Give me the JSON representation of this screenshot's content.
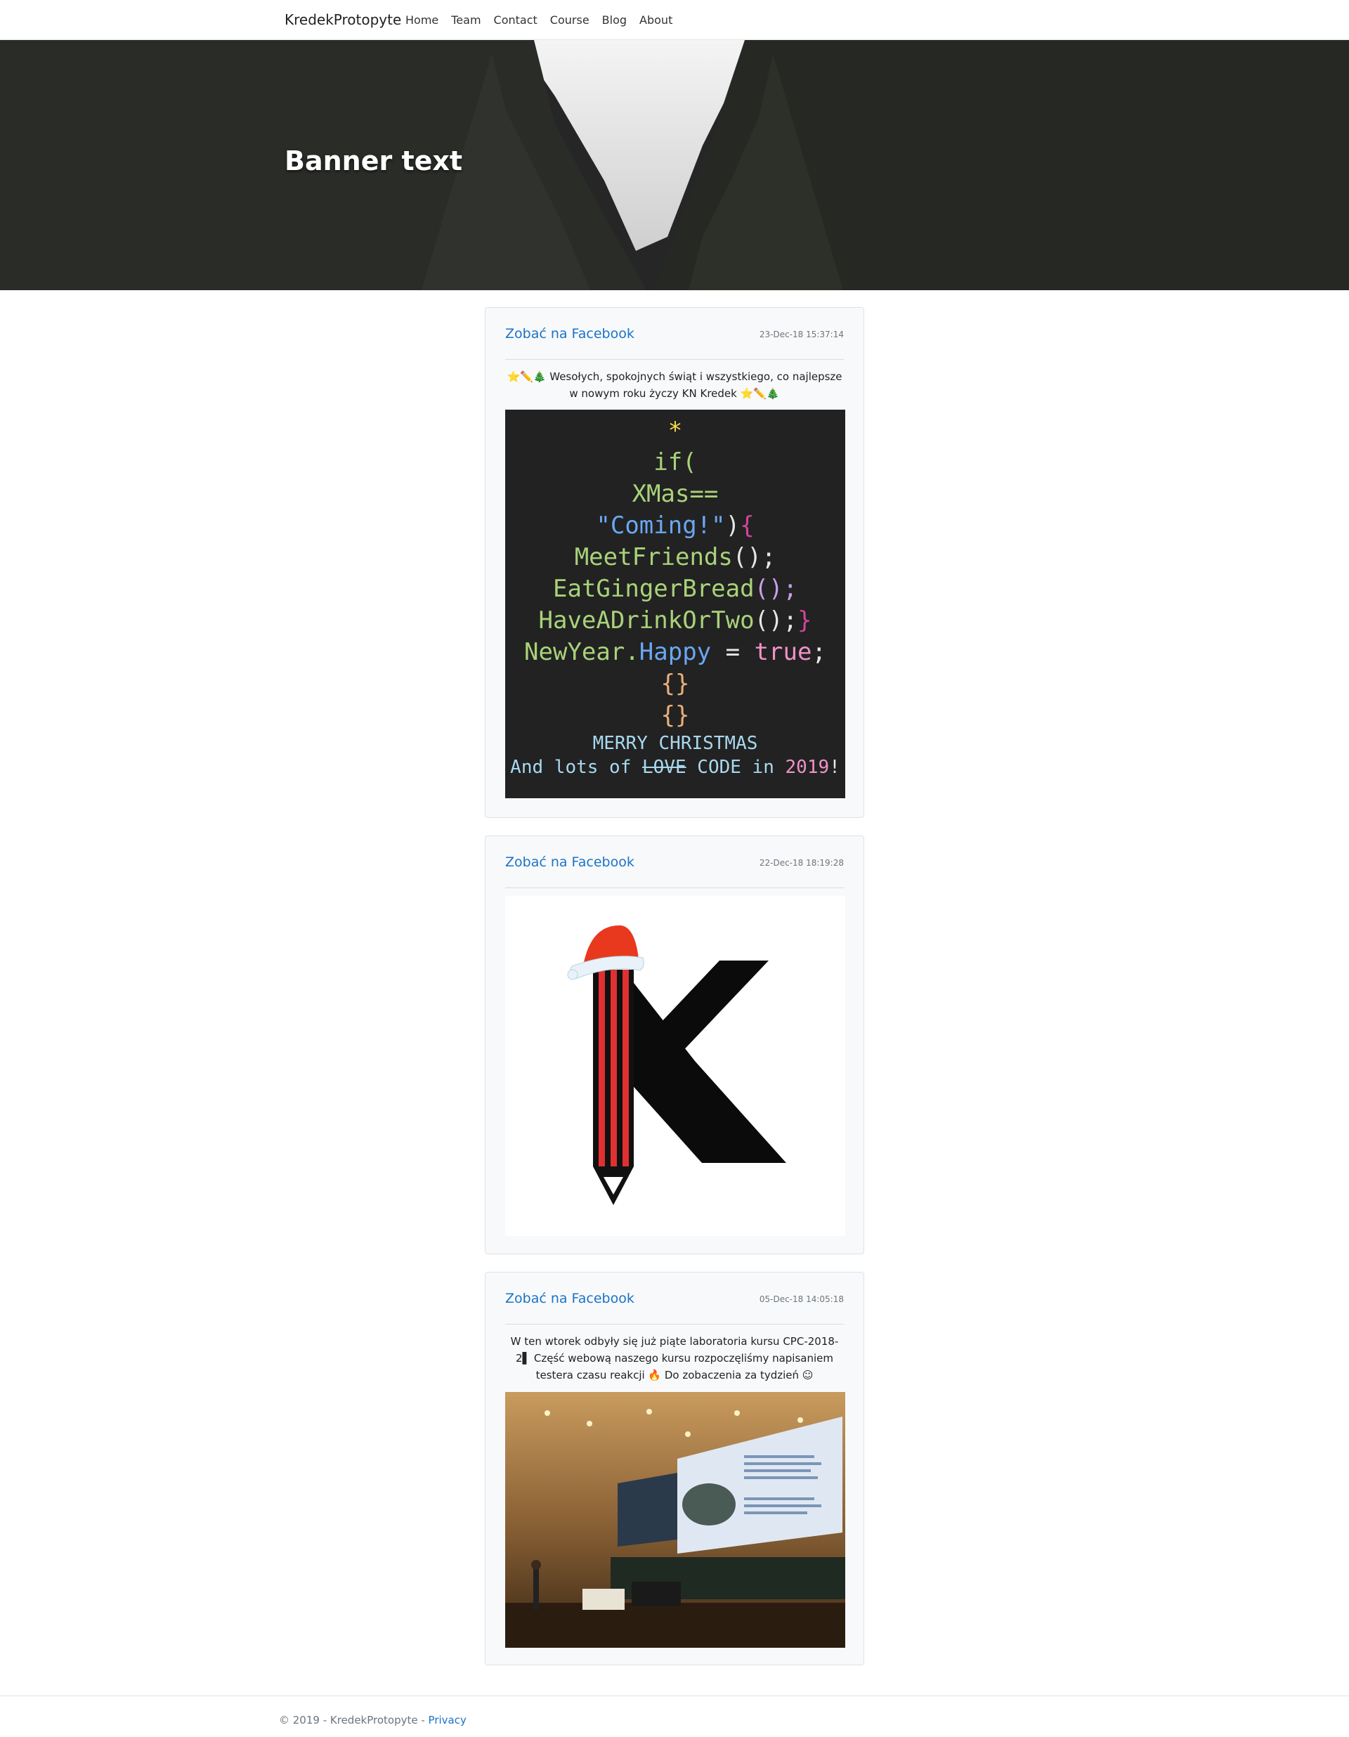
{
  "nav": {
    "brand": "KredekProtopyte",
    "items": [
      "Home",
      "Team",
      "Contact",
      "Course",
      "Blog",
      "About"
    ]
  },
  "banner": {
    "title": "Banner text"
  },
  "posts": [
    {
      "link": "Zobać na Facebook",
      "timestamp": "23-Dec-18 15:37:14",
      "text": "⭐✏️🎄 Wesołych, spokojnych świąt i wszystkiego, co najlepsze w nowym roku życzy KN Kredek ⭐✏️🎄",
      "image": {
        "star": "*",
        "l1": "if(",
        "l2": "XMas==",
        "l3a": "\"Coming!\"",
        "l3b": ")",
        "l3c": "{",
        "l4a": "MeetFriends",
        "l4b": "();",
        "l5a": "EatGingerBread",
        "l5b": "();",
        "l6a": "HaveADrinkOrTwo",
        "l6b": "();",
        "l6c": "}",
        "l7a": "NewYear.",
        "l7b": "Happy",
        "l7c": " = ",
        "l7d": "true",
        "l7e": ";",
        "l8": "{}",
        "l9": "{}",
        "l10": "MERRY CHRISTMAS",
        "l11a": "And lots of ",
        "l11b": "LOVE",
        "l11c": " CODE in ",
        "l11d": "2019",
        "l11e": "!"
      }
    },
    {
      "link": "Zobać na Facebook",
      "timestamp": "22-Dec-18 18:19:28"
    },
    {
      "link": "Zobać na Facebook",
      "timestamp": "05-Dec-18 14:05:18",
      "text": "W ten wtorek odbyły się już piąte laboratoria kursu CPC-2018-2▌ Część webową naszego kursu rozpoczęliśmy napisaniem testera czasu reakcji 🔥 Do zobaczenia za tydzień ☺"
    }
  ],
  "footer": {
    "copyright": "© 2019 - KredekProtopyte - ",
    "privacy": "Privacy"
  },
  "colors": {
    "link": "#1a73c8",
    "card_bg": "#f8f9fa"
  }
}
